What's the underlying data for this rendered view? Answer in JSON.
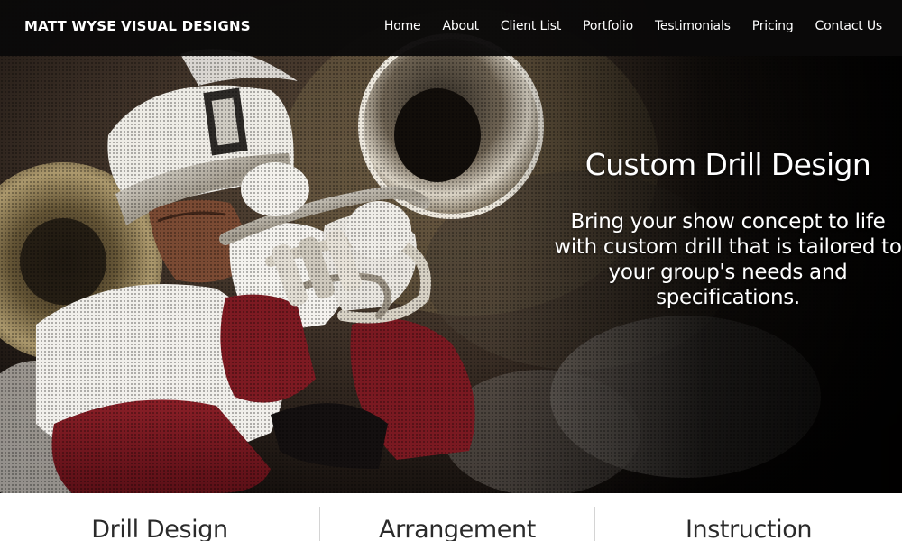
{
  "brand": {
    "name": "MATT WYSE VISUAL DESIGNS"
  },
  "nav": {
    "items": [
      {
        "label": "Home"
      },
      {
        "label": "About"
      },
      {
        "label": "Client List"
      },
      {
        "label": "Portfolio"
      },
      {
        "label": "Testimonials"
      },
      {
        "label": "Pricing"
      },
      {
        "label": "Contact Us"
      }
    ]
  },
  "hero": {
    "title": "Custom Drill Design",
    "body": "Bring your show concept to life with custom drill that is tailored to your group's needs and specifications.",
    "image": "marching-band-mellophone-player-photo"
  },
  "services": {
    "items": [
      {
        "title": "Drill Design"
      },
      {
        "title": "Arrangement"
      },
      {
        "title": "Instruction"
      }
    ]
  },
  "colors": {
    "header_bg": "#0a0909",
    "hero_text": "#ffffff",
    "service_text": "#2a2a2a",
    "uniform_red": "#7a1a22",
    "uniform_white": "#f2f0ec",
    "brass": "#b8a47a"
  }
}
